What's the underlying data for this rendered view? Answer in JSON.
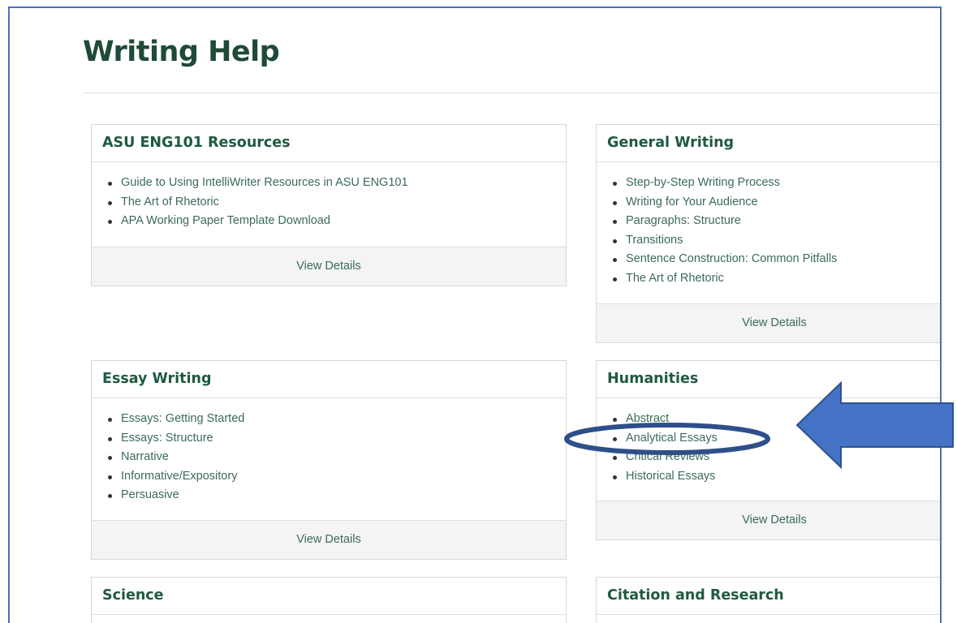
{
  "page": {
    "title": "Writing Help"
  },
  "cards": [
    {
      "title": "ASU ENG101 Resources",
      "items": [
        "Guide to Using IntelliWriter Resources in ASU ENG101",
        "The Art of Rhetoric",
        "APA Working Paper Template Download"
      ],
      "footer": "View Details"
    },
    {
      "title": "General Writing",
      "items": [
        "Step-by-Step Writing Process",
        "Writing for Your Audience",
        "Paragraphs: Structure",
        "Transitions",
        "Sentence Construction: Common Pitfalls",
        "The Art of Rhetoric"
      ],
      "footer": "View Details"
    },
    {
      "title": "Essay Writing",
      "items": [
        "Essays: Getting Started",
        "Essays: Structure",
        "Narrative",
        "Informative/Expository",
        "Persuasive"
      ],
      "footer": "View Details"
    },
    {
      "title": "Humanities",
      "items": [
        "Abstract",
        "Analytical Essays",
        "Critical Reviews",
        "Historical Essays"
      ],
      "footer": "View Details"
    },
    {
      "title": "Science"
    },
    {
      "title": "Citation and Research"
    }
  ],
  "annotations": {
    "arrow_color": "#4472c4",
    "ellipse_color": "#2f4f8a",
    "arrow_icon": "left-arrow-icon",
    "highlight_shape": "ellipse-highlight"
  }
}
